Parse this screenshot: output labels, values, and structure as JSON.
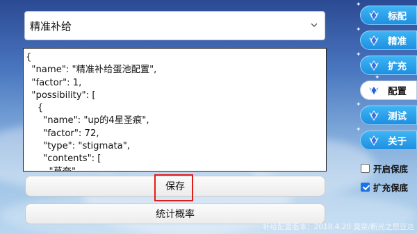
{
  "selector": {
    "value": "精准补给"
  },
  "editor": {
    "lines": [
      "{",
      "  \"name\": \"精准补给蛋池配置\",",
      "  \"factor\": 1,",
      "  \"possibility\": [",
      "    {",
      "      \"name\": \"up的4星圣痕\",",
      "      \"factor\": 72,",
      "      \"type\": \"stigmata\",",
      "      \"contents\": [",
      "        \"莫奈\"",
      "      ]"
    ]
  },
  "buttons": {
    "save": "保存",
    "stats": "统计概率"
  },
  "tabs": [
    {
      "label": "标配",
      "icon": "winged-crystal-icon"
    },
    {
      "label": "精准",
      "icon": "winged-crystal-icon"
    },
    {
      "label": "扩充",
      "icon": "winged-crystal-icon"
    },
    {
      "label": "配置",
      "icon": "winged-crystal-icon"
    },
    {
      "label": "测试",
      "icon": "winged-crystal-icon"
    },
    {
      "label": "关于",
      "icon": "winged-crystal-icon"
    }
  ],
  "active_tab": "配置",
  "options": {
    "guarantee": {
      "label": "开启保底",
      "checked": false
    },
    "expand_guarantee": {
      "label": "扩充保底",
      "checked": true
    }
  },
  "footer": "补给配置版本：2018.4.20 莫奈/断光之怒亚达",
  "colors": {
    "tab_blue": "#1d8ee0",
    "highlight_red": "#e21b1b",
    "checkbox_blue": "#1a73e8"
  }
}
